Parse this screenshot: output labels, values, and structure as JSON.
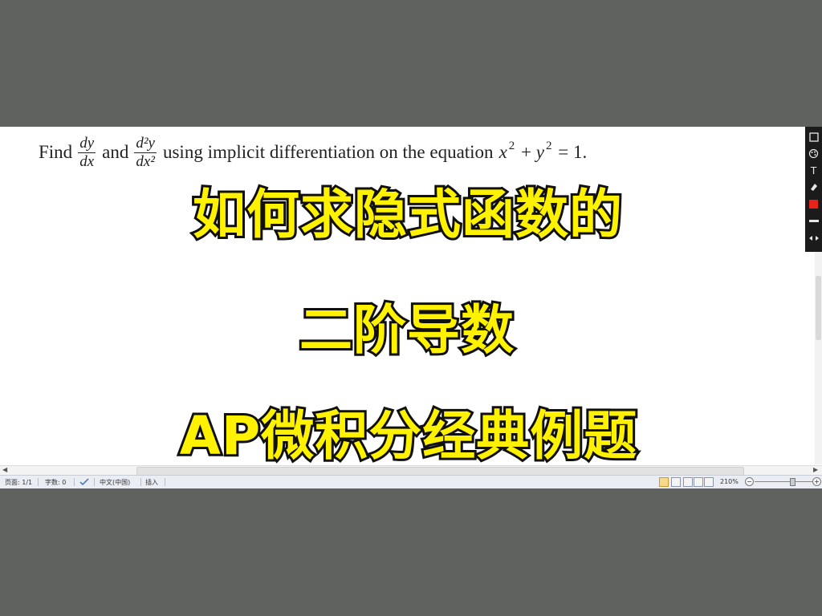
{
  "problem": {
    "find": "Find",
    "dy_num": "dy",
    "dy_den": "dx",
    "and": "and",
    "d2y_num": "d²y",
    "d2y_den": "dx²",
    "rest": "using implicit differentiation on the equation",
    "eq_x": "x",
    "eq_exp1": "2",
    "eq_plus": "+",
    "eq_y": "y",
    "eq_exp2": "2",
    "eq_rhs": "= 1."
  },
  "overlay": {
    "line1": "如何求隐式函数的",
    "line2": "二阶导数",
    "line3": "AP微积分经典例题"
  },
  "toolbar": {
    "items": [
      "square-icon",
      "palette-icon",
      "text-icon",
      "eraser-icon",
      "red-color",
      "line-width",
      "arrows-icon"
    ],
    "labels": {
      "text": "T"
    },
    "accent_color": "#e8231c"
  },
  "status": {
    "page": "页面: 1/1",
    "words": "字数: 0",
    "language": "中文(中国)",
    "mode": "插入",
    "zoom": "210%"
  }
}
